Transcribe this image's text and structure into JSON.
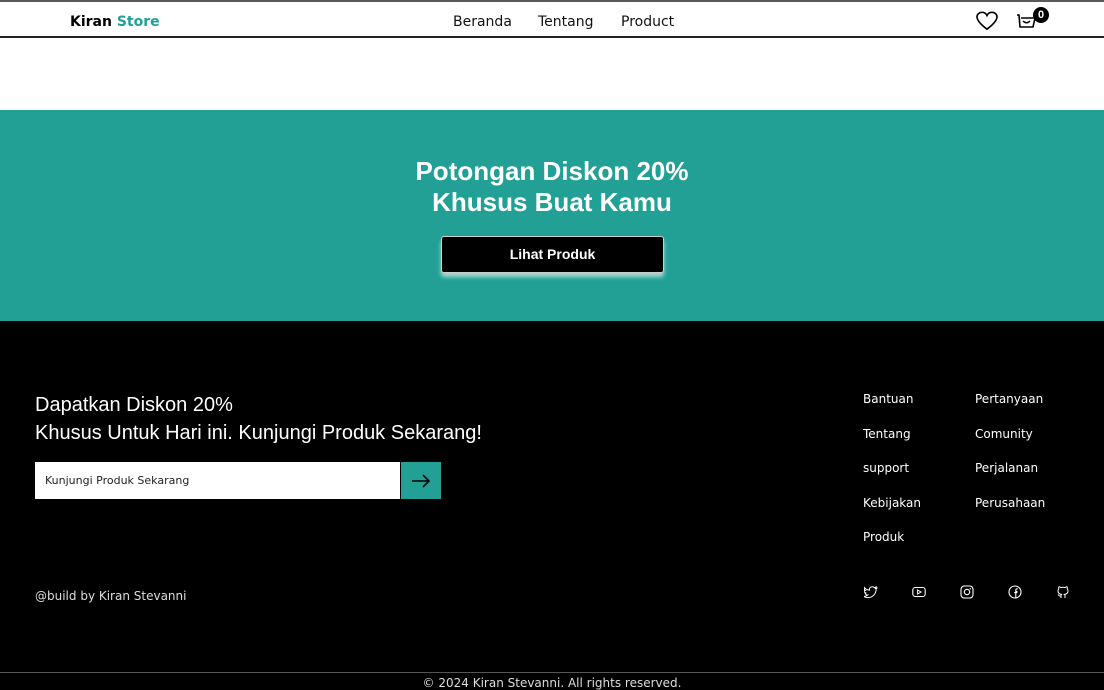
{
  "navbar": {
    "brand_main": "Kiran",
    "brand_accent": "Store",
    "links": [
      "Beranda",
      "Tentang",
      "Product"
    ],
    "cart_count": "0"
  },
  "promo": {
    "title_line1": "Potongan Diskon 20%",
    "title_line2": "Khusus Buat Kamu",
    "button_label": "Lihat Produk",
    "bg_color": "#22a095"
  },
  "footer": {
    "headline_line1": "Dapatkan Diskon 20%",
    "headline_line2": "Khusus Untuk Hari ini. Kunjungi Produk Sekarang!",
    "input_value": "Kunjungi Produk Sekarang",
    "credit": "@build by Kiran Stevanni",
    "links_col1": [
      "Bantuan",
      "Tentang",
      "support",
      "Kebijakan",
      "Produk"
    ],
    "links_col2": [
      "Pertanyaan",
      "Comunity",
      "Perjalanan",
      "Perusahaan"
    ],
    "social_icons": [
      "twitter-icon",
      "youtube-icon",
      "instagram-icon",
      "facebook-icon",
      "github-icon"
    ],
    "copyright": "© 2024 Kiran Stevanni. All rights reserved."
  }
}
